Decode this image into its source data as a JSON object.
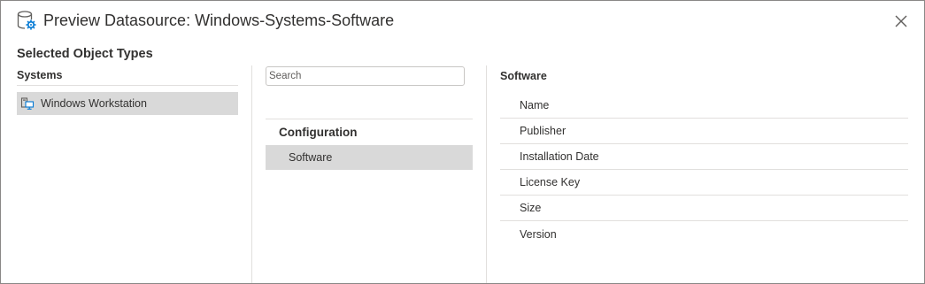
{
  "header": {
    "title": "Preview Datasource: Windows-Systems-Software",
    "icon": "datasource-gear-icon",
    "close_icon": "close-icon"
  },
  "subtitle": "Selected Object Types",
  "systems": {
    "header": "Systems",
    "items": [
      {
        "label": "Windows Workstation",
        "icon": "workstation-icon",
        "selected": true
      }
    ]
  },
  "categories": {
    "search_placeholder": "Search",
    "search_value": "",
    "groups": [
      {
        "label": "Configuration",
        "items": [
          {
            "label": "Software",
            "selected": true
          }
        ]
      }
    ]
  },
  "fields": {
    "header": "Software",
    "items": [
      "Name",
      "Publisher",
      "Installation Date",
      "License Key",
      "Size",
      "Version"
    ]
  },
  "colors": {
    "selected_bg": "#d9d9d9",
    "accent": "#0078d4",
    "divider": "#e1dfdd",
    "text": "#323130"
  }
}
